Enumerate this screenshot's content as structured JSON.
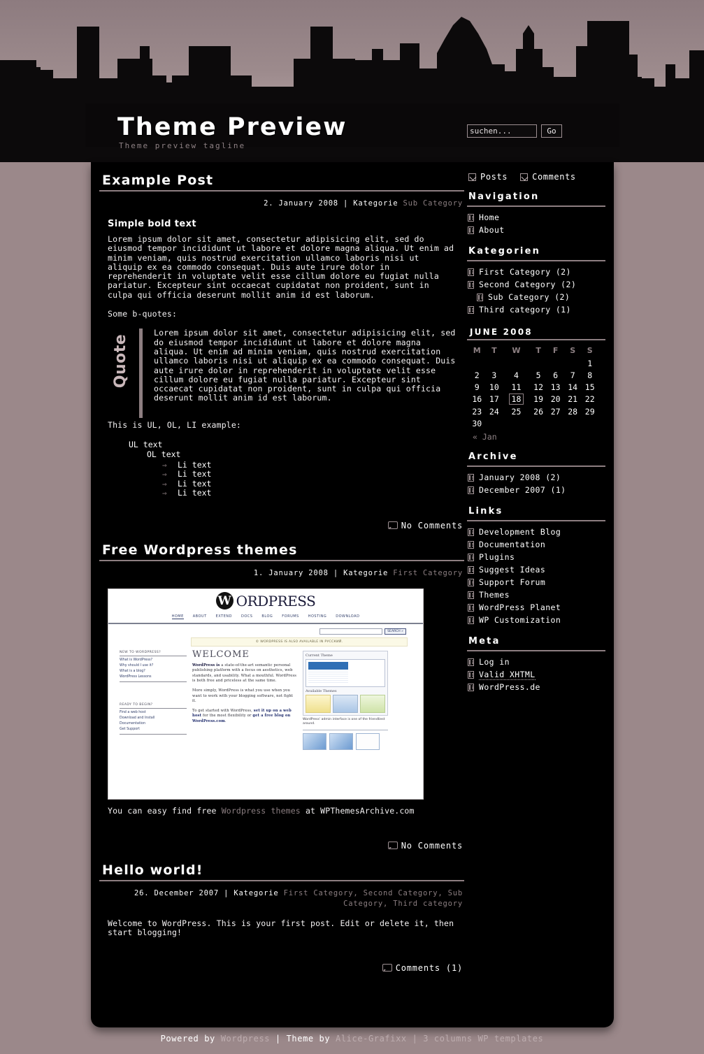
{
  "header": {
    "title": "Theme Preview",
    "tagline": "Theme preview tagline",
    "search": {
      "placeholder": "suchen...",
      "value": "",
      "button": "Go"
    }
  },
  "posts": [
    {
      "title": "Example Post",
      "date": "2. January 2008",
      "meta_sep": " | Kategorie ",
      "categories": "Sub Category",
      "heading": "Simple bold text",
      "paragraph": "Lorem ipsum dolor sit amet, consectetur adipisicing elit, sed do eiusmod tempor incididunt ut labore et dolore magna aliqua. Ut enim ad minim veniam, quis nostrud exercitation ullamco laboris nisi ut aliquip ex ea commodo consequat. Duis aute irure dolor in reprehenderit in voluptate velit esse cillum dolore eu fugiat nulla pariatur. Excepteur sint occaecat cupidatat non proident, sunt in culpa qui officia deserunt mollit anim id est laborum.",
      "quote_intro": "Some b-quotes:",
      "quote_label": "Quote",
      "quote_text": "Lorem ipsum dolor sit amet, consectetur adipisicing elit, sed do eiusmod tempor incididunt ut labore et dolore magna aliqua. Ut enim ad minim veniam, quis nostrud exercitation ullamco laboris nisi ut aliquip ex ea commodo consequat. Duis aute irure dolor in reprehenderit in voluptate velit esse cillum dolore eu fugiat nulla pariatur. Excepteur sint occaecat cupidatat non proident, sunt in culpa qui officia deserunt mollit anim id est laborum.",
      "list_intro": "This is UL, OL, LI example:",
      "ul_text": "UL text",
      "ol_text": "OL text",
      "li_items": [
        "Li text",
        "Li text",
        "Li text",
        "Li text"
      ],
      "comments": "No Comments"
    },
    {
      "title": "Free Wordpress themes",
      "date": "1. January 2008",
      "meta_sep": " | Kategorie ",
      "categories": "First Category",
      "caption_pre": "You can easy find free ",
      "caption_link": "Wordpress themes",
      "caption_post": " at WPThemesArchive.com",
      "comments": "No Comments"
    },
    {
      "title": "Hello world!",
      "date": "26. December 2007",
      "meta_sep": " | Kategorie ",
      "categories": "First Category, Second Category, Sub Category, Third category",
      "paragraph": "Welcome to WordPress. This is your first post. Edit or delete it, then start blogging!",
      "comments": "Comments (1)"
    }
  ],
  "screenshot": {
    "brand_mark": "W",
    "brand_word": "ORDPRESS",
    "nav": [
      "HOME",
      "ABOUT",
      "EXTEND",
      "DOCS",
      "BLOG",
      "FORUMS",
      "HOSTING",
      "DOWNLOAD"
    ],
    "search_button": "SEARCH »",
    "notice": "© WORDPRESS IS ALSO AVAILABLE IN РУССКИЙ.",
    "welcome": "WELCOME",
    "left_col": {
      "heading1": "NEW TO WORDPRESS?",
      "links1": [
        "What is WordPress?",
        "Why should I use it?",
        "What is a blog?",
        "WordPress Lessons"
      ],
      "heading2": "READY TO BEGIN?",
      "links2": [
        "Find a web host",
        "Download and Install",
        "Documentation",
        "Get Support"
      ]
    },
    "body1_bold": "WordPress is",
    "body1": " a state-of-the-art semantic personal publishing platform with a focus on aesthetics, web standards, and usability. What a mouthful. WordPress is both free and priceless at the same time.",
    "body2": "More simply, WordPress is what you use when you want to work with your blogging software, not fight it.",
    "body3_pre": "To get started with WordPress, ",
    "body3_link1": "set it up on a web host",
    "body3_mid": " for the most flexibility or ",
    "body3_link2": "get a free blog on WordPress.com",
    "body3_post": ".",
    "panel1_title": "Current Theme",
    "panel2_title": "Available Themes",
    "panel_caption": "WordPress' admin interface is one of the friendliest around."
  },
  "sidebar": {
    "feeds": [
      {
        "label": "Posts",
        "icon": "rss-icon"
      },
      {
        "label": "Comments",
        "icon": "rss-icon"
      }
    ],
    "sections": [
      {
        "heading": "Navigation",
        "items": [
          {
            "label": "Home",
            "sub": false
          },
          {
            "label": "About",
            "sub": false
          }
        ]
      },
      {
        "heading": "Kategorien",
        "items": [
          {
            "label": "First Category (2)",
            "sub": false
          },
          {
            "label": "Second Category (2)",
            "sub": false
          },
          {
            "label": "Sub Category (2)",
            "sub": true
          },
          {
            "label": "Third category (1)",
            "sub": false
          }
        ]
      }
    ],
    "calendar": {
      "title": "JUNE 2008",
      "weekdays": [
        "M",
        "T",
        "W",
        "T",
        "F",
        "S",
        "S"
      ],
      "weeks": [
        [
          "",
          "",
          "",
          "",
          "",
          "",
          "1"
        ],
        [
          "2",
          "3",
          "4",
          "5",
          "6",
          "7",
          "8"
        ],
        [
          "9",
          "10",
          "11",
          "12",
          "13",
          "14",
          "15"
        ],
        [
          "16",
          "17",
          "18",
          "19",
          "20",
          "21",
          "22"
        ],
        [
          "23",
          "24",
          "25",
          "26",
          "27",
          "28",
          "29"
        ],
        [
          "30",
          "",
          "",
          "",
          "",
          "",
          ""
        ]
      ],
      "today": "18",
      "prev_link": "« Jan"
    },
    "sections2": [
      {
        "heading": "Archive",
        "items": [
          {
            "label": "January 2008 (2)",
            "sub": false
          },
          {
            "label": "December 2007 (1)",
            "sub": false
          }
        ]
      },
      {
        "heading": "Links",
        "items": [
          {
            "label": "Development Blog",
            "sub": false
          },
          {
            "label": "Documentation",
            "sub": false
          },
          {
            "label": "Plugins",
            "sub": false
          },
          {
            "label": "Suggest Ideas",
            "sub": false
          },
          {
            "label": "Support Forum",
            "sub": false
          },
          {
            "label": "Themes",
            "sub": false
          },
          {
            "label": "WordPress Planet",
            "sub": false
          },
          {
            "label": "WP Customization",
            "sub": false
          }
        ]
      },
      {
        "heading": "Meta",
        "items": [
          {
            "label": "Log in",
            "sub": false
          },
          {
            "label": "Valid XHTML",
            "sub": false
          },
          {
            "label": "WordPress.de",
            "sub": false
          }
        ]
      }
    ]
  },
  "footer": {
    "powered_label": "Powered by ",
    "powered_link": "Wordpress",
    "sep1": " | ",
    "theme_label": "Theme by ",
    "theme_link": "Alice-Grafixx",
    "sep2": " | ",
    "templates_link": "3 columns WP templates"
  },
  "colors": {
    "page_bg": "#9b888a",
    "content_bg": "#000000",
    "accent_rule": "#8d7e81",
    "link_dim": "#8b7e81"
  }
}
